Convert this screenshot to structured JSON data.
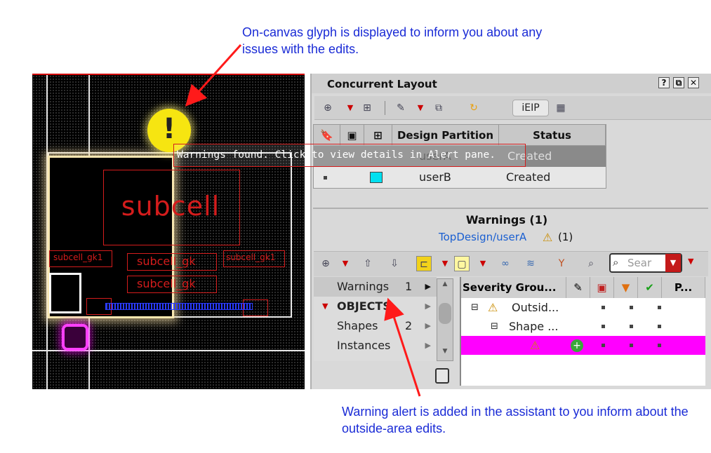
{
  "callouts": {
    "top": "On-canvas glyph is displayed to inform you about any issues with the edits.",
    "bottom": "Warning alert is added in the assistant to you inform about the outside-area edits."
  },
  "canvas": {
    "glyph_label": "!",
    "subcell_label": "subcell",
    "labels": [
      "subcell_gk1",
      "subcell_gk",
      "subcell_gk",
      "subcell_gk1"
    ]
  },
  "tooltip": "Warnings found. Click to view details in Alert pane.",
  "panel": {
    "title": "Concurrent Layout",
    "buttons": {
      "help": "?",
      "float": "⧉",
      "close": "✕"
    },
    "toolbar": {
      "ieip_label": "iEIP"
    }
  },
  "partition_table": {
    "headers": [
      "Design Partition",
      "Status"
    ],
    "rows": [
      {
        "name": "userA",
        "status": "Created",
        "color": "#1aa0d0"
      },
      {
        "name": "userB",
        "status": "Created",
        "color": "#00e0f0"
      }
    ]
  },
  "warnings": {
    "title": "Warnings (1)",
    "path": "TopDesign/userA",
    "count": "(1)",
    "search_placeholder": "Sear",
    "nav": [
      {
        "label": "Warnings",
        "count": "1"
      },
      {
        "label": "OBJECTS",
        "count": ""
      },
      {
        "label": "Shapes",
        "count": "2"
      },
      {
        "label": "Instances",
        "count": ""
      }
    ],
    "tree_headers": [
      "Severity Grou...",
      "P..."
    ],
    "tree_rows": [
      "Outsid...",
      "Shape ...",
      ""
    ]
  },
  "colors": {
    "accent": "#1a2bd6",
    "highlight": "#ff00ff",
    "warning": "#f2d21a"
  }
}
